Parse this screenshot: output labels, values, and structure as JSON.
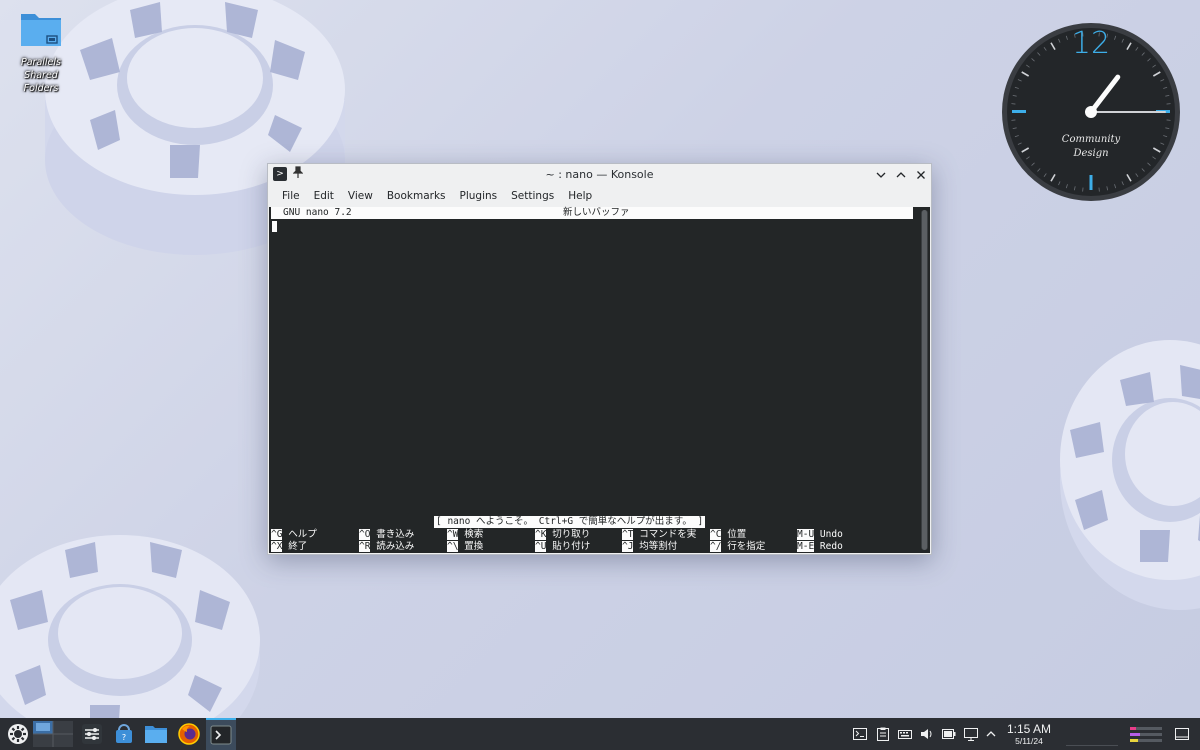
{
  "desktop": {
    "icons": [
      {
        "label": "Parallels Shared Folders",
        "icon": "folder-icon"
      }
    ]
  },
  "clock_widget": {
    "hour_numeral": "12",
    "caption_line1": "Community",
    "caption_line2": "Design",
    "time": {
      "hour": 1,
      "minute": 15
    },
    "accent_color": "#3daee9"
  },
  "window": {
    "title": "~ : nano — Konsole",
    "menu": [
      "File",
      "Edit",
      "View",
      "Bookmarks",
      "Plugins",
      "Settings",
      "Help"
    ],
    "controls": [
      "minimize",
      "maximize",
      "close"
    ],
    "terminal": {
      "header_version": "GNU nano 7.2",
      "header_buffer": "新しいバッファ",
      "status_message": "[ nano へようこそ。 Ctrl+G で簡単なヘルプが出ます。 ]",
      "shortcuts_row1": [
        {
          "key": "^G",
          "label": "ヘルプ"
        },
        {
          "key": "^O",
          "label": "書き込み"
        },
        {
          "key": "^W",
          "label": "検索"
        },
        {
          "key": "^K",
          "label": "切り取り"
        },
        {
          "key": "^T",
          "label": "コマンドを実"
        },
        {
          "key": "^C",
          "label": "位置"
        },
        {
          "key": "M-U",
          "label": "Undo"
        }
      ],
      "shortcuts_row2": [
        {
          "key": "^X",
          "label": "終了"
        },
        {
          "key": "^R",
          "label": "読み込み"
        },
        {
          "key": "^\\",
          "label": "置換"
        },
        {
          "key": "^U",
          "label": "貼り付け"
        },
        {
          "key": "^J",
          "label": "均等割付"
        },
        {
          "key": "^/",
          "label": "行を指定"
        },
        {
          "key": "M-E",
          "label": "Redo"
        }
      ]
    }
  },
  "taskbar": {
    "launchers": [
      "app-launcher-icon",
      "pager-icon",
      "system-settings-icon",
      "discover-store-icon",
      "dolphin-files-icon",
      "firefox-icon",
      "konsole-icon"
    ],
    "tray": [
      "terminal-tray-icon",
      "clipboard-icon",
      "keyboard-icon",
      "volume-icon",
      "battery-icon",
      "network-icon",
      "expand-tray-icon"
    ],
    "clock_time": "1:15 AM",
    "clock_date": "5/11/24"
  }
}
